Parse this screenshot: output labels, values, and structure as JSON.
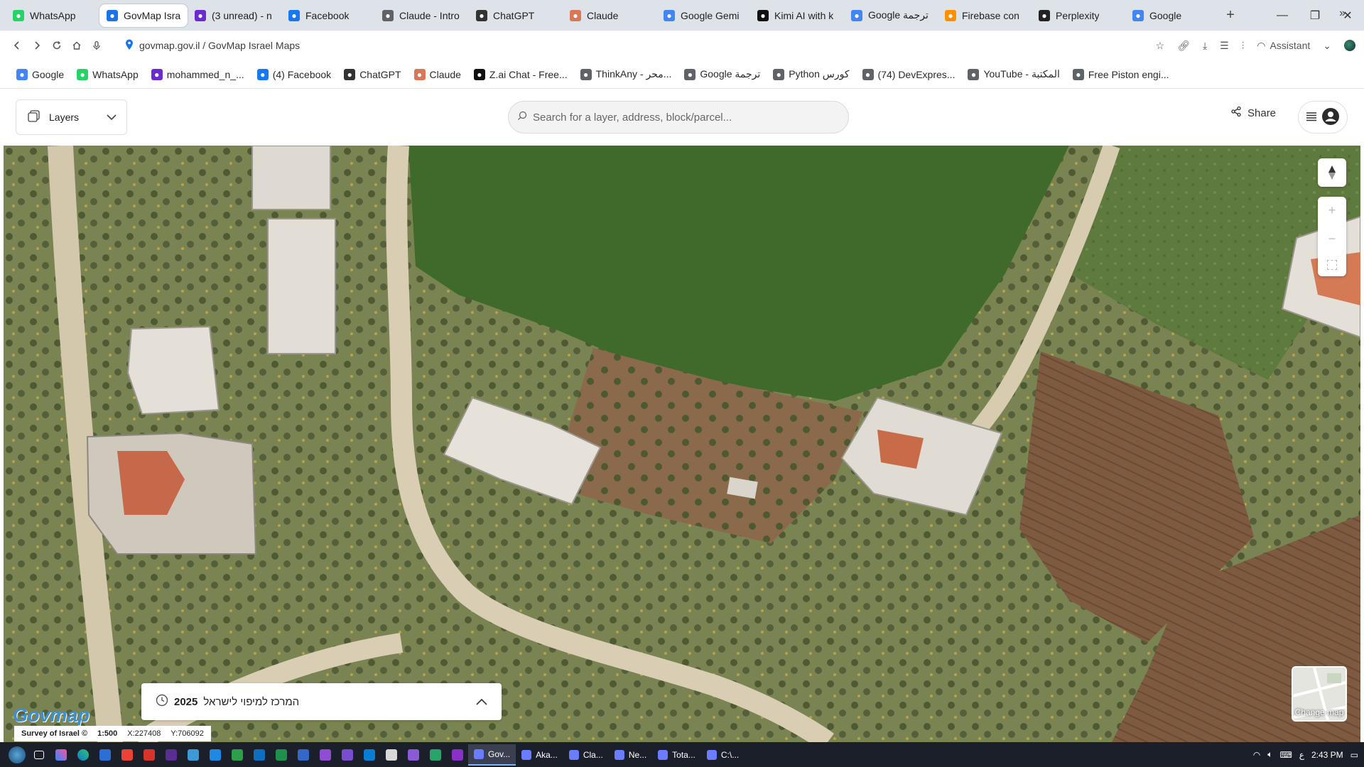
{
  "browser": {
    "tabs": [
      {
        "label": "WhatsApp",
        "icon": "whatsapp-icon",
        "color": "#25d366",
        "active": false
      },
      {
        "label": "GovMap Israel",
        "icon": "location-pin-icon",
        "color": "#1a73e8",
        "active": true
      },
      {
        "label": "(3 unread) - n",
        "icon": "mail-icon",
        "color": "#6b2bd1",
        "active": false
      },
      {
        "label": "Facebook",
        "icon": "facebook-icon",
        "color": "#1877f2",
        "active": false
      },
      {
        "label": "Claude - Intro",
        "icon": "globe-icon",
        "color": "#5f6368",
        "active": false
      },
      {
        "label": "ChatGPT",
        "icon": "chatgpt-icon",
        "color": "#333333",
        "active": false
      },
      {
        "label": "Claude",
        "icon": "claude-icon",
        "color": "#d97757",
        "active": false
      },
      {
        "label": "Google Gemi",
        "icon": "gemini-icon",
        "color": "#4285f4",
        "active": false
      },
      {
        "label": "Kimi AI with k",
        "icon": "kimi-icon",
        "color": "#111111",
        "active": false
      },
      {
        "label": "Google ترجمة",
        "icon": "translate-icon",
        "color": "#4285f4",
        "active": false
      },
      {
        "label": "Firebase con",
        "icon": "firebase-icon",
        "color": "#ff9100",
        "active": false
      },
      {
        "label": "Perplexity",
        "icon": "perplexity-icon",
        "color": "#222222",
        "active": false
      },
      {
        "label": "Google",
        "icon": "google-icon",
        "color": "#4285f4",
        "active": false
      }
    ],
    "new_tab": "+",
    "window_controls": {
      "minimize": "—",
      "restore": "❐",
      "close": "✕"
    },
    "address": {
      "text": "govmap.gov.il / GovMap Israel Maps",
      "assistant": "Assistant"
    },
    "bookmarks": [
      {
        "label": "Google",
        "icon": "google-icon",
        "color": "#4285f4"
      },
      {
        "label": "WhatsApp",
        "icon": "whatsapp-icon",
        "color": "#25d366"
      },
      {
        "label": "mohammed_n_...",
        "icon": "mail-icon",
        "color": "#6b2bd1"
      },
      {
        "label": "(4) Facebook",
        "icon": "facebook-icon",
        "color": "#1877f2"
      },
      {
        "label": "ChatGPT",
        "icon": "chatgpt-icon",
        "color": "#333333"
      },
      {
        "label": "Claude",
        "icon": "claude-icon",
        "color": "#d97757"
      },
      {
        "label": "Z.ai Chat - Free...",
        "icon": "zai-icon",
        "color": "#111111"
      },
      {
        "label": "ThinkAny - محر...",
        "icon": "globe-icon",
        "color": "#5f6368"
      },
      {
        "label": "Google ترجمة",
        "icon": "globe-icon",
        "color": "#5f6368"
      },
      {
        "label": "Python كورس",
        "icon": "folder-icon",
        "color": "#5f6368"
      },
      {
        "label": "(74) DevExpres...",
        "icon": "globe-icon",
        "color": "#5f6368"
      },
      {
        "label": "YouTube - المكتبة",
        "icon": "globe-icon",
        "color": "#5f6368"
      },
      {
        "label": "Free Piston engi...",
        "icon": "globe-icon",
        "color": "#5f6368"
      }
    ],
    "bookmarks_more": "»"
  },
  "app": {
    "layers_label": "Layers",
    "search_placeholder": "Search for a layer, address, block/parcel...",
    "share_label": "Share",
    "year_panel": {
      "text": "המרכז למיפוי לישראל",
      "year": "2025"
    },
    "logo": "Govmap",
    "scale": {
      "survey": "Survey of Israel ©",
      "scale": "1:500",
      "x": "X:227408",
      "y": "Y:706092"
    },
    "change_map_label": "Change map",
    "zoom_in": "+",
    "zoom_out": "−"
  },
  "taskbar": {
    "apps": [
      {
        "label": "Gov...",
        "active": true
      },
      {
        "label": "Aka...",
        "active": false
      },
      {
        "label": "Cla...",
        "active": false
      },
      {
        "label": "Ne...",
        "active": false
      },
      {
        "label": "Tota...",
        "active": false
      },
      {
        "label": "C:\\...",
        "active": false
      }
    ],
    "time": "2:43 PM",
    "lang": "ع"
  }
}
